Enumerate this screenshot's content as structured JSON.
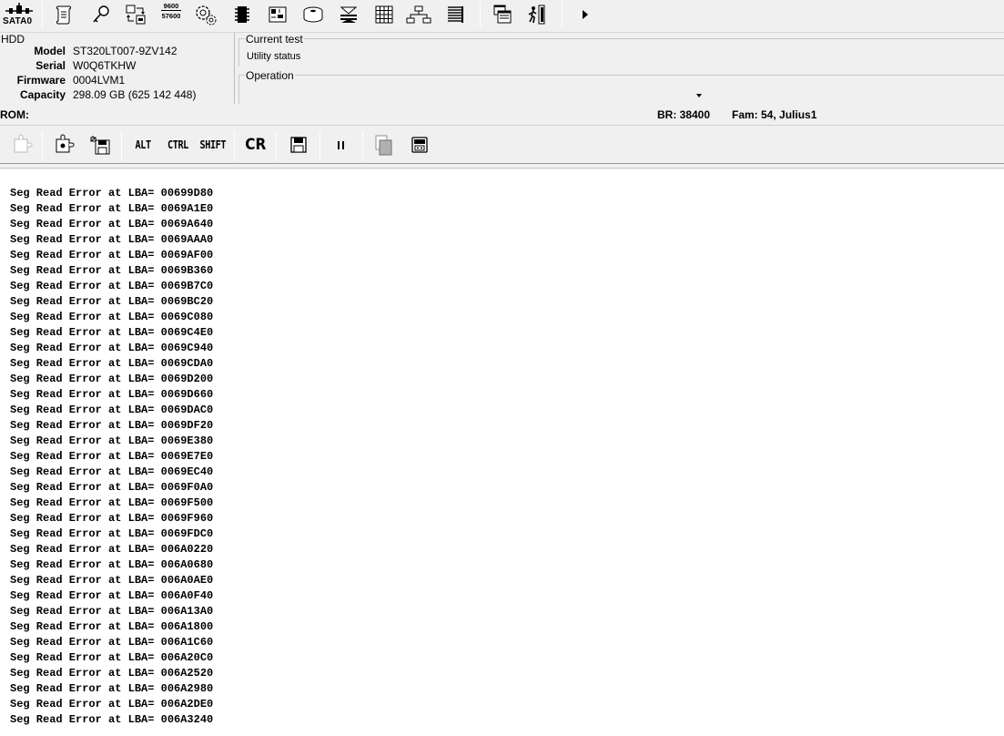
{
  "toolbar": {
    "port_label": "SATA0",
    "baud_top": "9600",
    "baud_bottom": "57600"
  },
  "hdd": {
    "title": "HDD",
    "fields": [
      {
        "label": "Model",
        "value": "ST320LT007-9ZV142"
      },
      {
        "label": "Serial",
        "value": "W0Q6TKHW"
      },
      {
        "label": "Firmware",
        "value": "0004LVM1"
      },
      {
        "label": "Capacity",
        "value": "298.09 GB (625 142 448)"
      }
    ]
  },
  "current_test": {
    "legend": "Current test",
    "value": "Utility status"
  },
  "operation": {
    "legend": "Operation",
    "value": ""
  },
  "status": {
    "rom": "ROM:",
    "br": "BR: 38400",
    "fam": "Fam: 54, Julius1"
  },
  "toolbar2": {
    "alt": "ALT",
    "ctrl": "CTRL",
    "shift": "SHIFT",
    "cr": "CR"
  },
  "log": [
    "Seg Read Error at LBA= 00699D80",
    "Seg Read Error at LBA= 0069A1E0",
    "Seg Read Error at LBA= 0069A640",
    "Seg Read Error at LBA= 0069AAA0",
    "Seg Read Error at LBA= 0069AF00",
    "Seg Read Error at LBA= 0069B360",
    "Seg Read Error at LBA= 0069B7C0",
    "Seg Read Error at LBA= 0069BC20",
    "Seg Read Error at LBA= 0069C080",
    "Seg Read Error at LBA= 0069C4E0",
    "Seg Read Error at LBA= 0069C940",
    "Seg Read Error at LBA= 0069CDA0",
    "Seg Read Error at LBA= 0069D200",
    "Seg Read Error at LBA= 0069D660",
    "Seg Read Error at LBA= 0069DAC0",
    "Seg Read Error at LBA= 0069DF20",
    "Seg Read Error at LBA= 0069E380",
    "Seg Read Error at LBA= 0069E7E0",
    "Seg Read Error at LBA= 0069EC40",
    "Seg Read Error at LBA= 0069F0A0",
    "Seg Read Error at LBA= 0069F500",
    "Seg Read Error at LBA= 0069F960",
    "Seg Read Error at LBA= 0069FDC0",
    "Seg Read Error at LBA= 006A0220",
    "Seg Read Error at LBA= 006A0680",
    "Seg Read Error at LBA= 006A0AE0",
    "Seg Read Error at LBA= 006A0F40",
    "Seg Read Error at LBA= 006A13A0",
    "Seg Read Error at LBA= 006A1800",
    "Seg Read Error at LBA= 006A1C60",
    "Seg Read Error at LBA= 006A20C0",
    "Seg Read Error at LBA= 006A2520",
    "Seg Read Error at LBA= 006A2980",
    "Seg Read Error at LBA= 006A2DE0",
    "Seg Read Error at LBA= 006A3240"
  ]
}
